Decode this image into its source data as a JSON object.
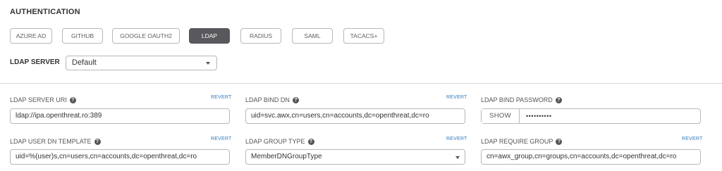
{
  "section": {
    "title": "AUTHENTICATION"
  },
  "tabs": [
    {
      "label": "AZURE AD",
      "active": false
    },
    {
      "label": "GITHUB",
      "active": false
    },
    {
      "label": "GOOGLE OAUTH2",
      "active": false
    },
    {
      "label": "LDAP",
      "active": true
    },
    {
      "label": "RADIUS",
      "active": false
    },
    {
      "label": "SAML",
      "active": false
    },
    {
      "label": "TACACS+",
      "active": false
    }
  ],
  "ldap_server": {
    "label": "LDAP SERVER",
    "selected": "Default"
  },
  "revert_label": "REVERT",
  "fields": {
    "server_uri": {
      "label": "LDAP SERVER URI",
      "value": "ldap://ipa.openthreat.ro:389"
    },
    "bind_dn": {
      "label": "LDAP BIND DN",
      "value": "uid=svc.awx,cn=users,cn=accounts,dc=openthreat,dc=ro"
    },
    "bind_password": {
      "label": "LDAP BIND PASSWORD",
      "show_label": "SHOW",
      "value": "••••••••••"
    },
    "user_dn_template": {
      "label": "LDAP USER DN TEMPLATE",
      "value": "uid=%(user)s,cn=users,cn=accounts,dc=openthreat,dc=ro"
    },
    "group_type": {
      "label": "LDAP GROUP TYPE",
      "value": "MemberDNGroupType"
    },
    "require_group": {
      "label": "LDAP REQUIRE GROUP",
      "value": "cn=awx_group,cn=groups,cn=accounts,dc=openthreat,dc=ro"
    }
  },
  "icons": {
    "help": "question-circle-icon",
    "dropdown": "caret-down-icon"
  },
  "colors": {
    "active_tab": "#58585d",
    "revert_link": "#337ab7",
    "border": "#b7b7b7"
  }
}
